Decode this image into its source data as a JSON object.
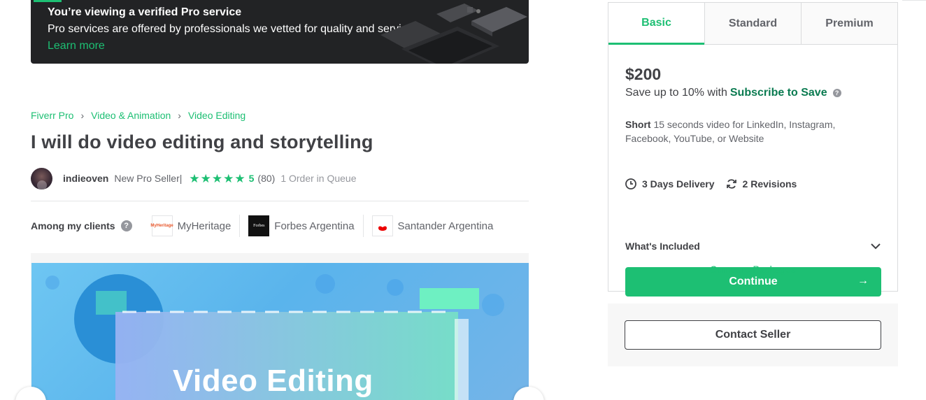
{
  "pro_banner": {
    "heading": "You’re viewing a verified Pro service",
    "text": "Pro services are offered by professionals we vetted for quality and service.",
    "link": "Learn more"
  },
  "breadcrumb": [
    "Fiverr Pro",
    "Video & Animation",
    "Video Editing"
  ],
  "gig_title": "I will do video editing and storytelling",
  "seller": {
    "name": "indieoven",
    "level": "New Pro Seller|",
    "rating": "5",
    "rating_count": "(80)",
    "queue": "1 Order in Queue"
  },
  "clients": {
    "label": "Among my clients",
    "help": "?",
    "items": [
      {
        "name": "MyHeritage",
        "logo_text": "MyHeritage"
      },
      {
        "name": "Forbes Argentina",
        "logo_text": "Forbes"
      },
      {
        "name": "Santander Argentina",
        "logo_text": ""
      }
    ]
  },
  "gallery": {
    "caption": "Video Editing",
    "prev": "‹",
    "next": "›"
  },
  "packages": {
    "tabs": [
      "Basic",
      "Standard",
      "Premium"
    ],
    "active_tab": "Basic",
    "price": "$200",
    "save_text": "Save up to 10% with",
    "subscribe_text": "Subscribe to Save",
    "desc_title": "Short",
    "desc_text": "15 seconds video for LinkedIn, Instagram, Facebook, YouTube, or Website",
    "delivery": "3 Days Delivery",
    "revisions": "2 Revisions",
    "whats_included": "What's Included",
    "continue": "Continue",
    "continue_arrow": "→",
    "compare": "Compare Packages"
  },
  "contact": {
    "label": "Contact Seller"
  },
  "colors": {
    "brand_green": "#1dbf73",
    "dark_green": "#0b7b51",
    "text": "#404145",
    "banner_bg": "#222325"
  }
}
